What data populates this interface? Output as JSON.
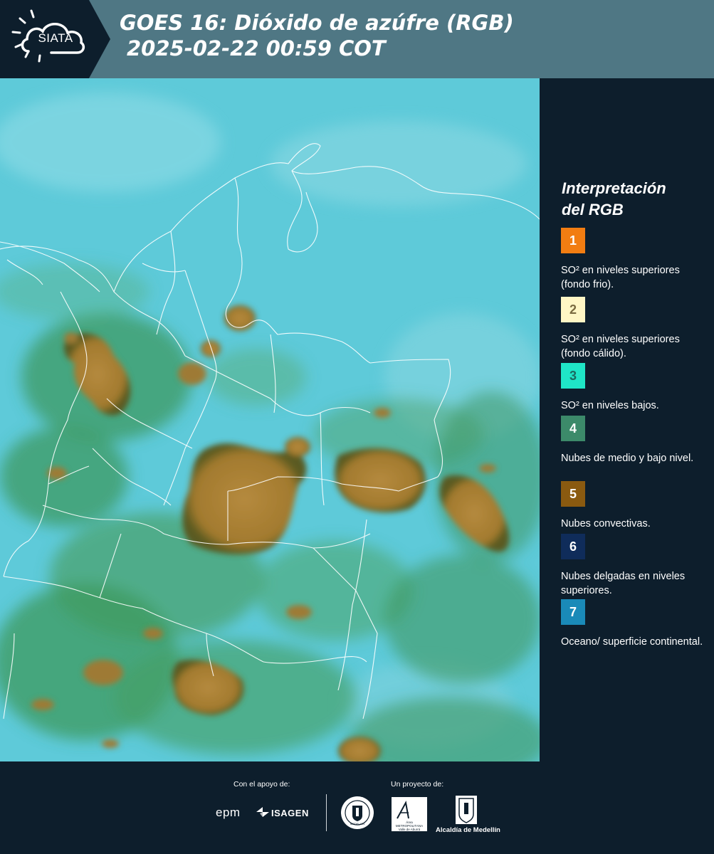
{
  "header": {
    "logo_text": "SIATA",
    "title_line1": "GOES 16: Dióxido de azúfre (RGB)",
    "title_line2": "2025-02-22 00:59 COT"
  },
  "legend": {
    "title_line1": "Interpretación",
    "title_line2": "del RGB",
    "items": [
      {
        "number": "1",
        "color": "#f27d12",
        "label": "SO² en niveles superiores (fondo frio)."
      },
      {
        "number": "2",
        "color": "#fff6c5",
        "label": "SO² en niveles superiores (fondo cálido)."
      },
      {
        "number": "3",
        "color": "#1fe6c7",
        "label": "SO² en niveles bajos."
      },
      {
        "number": "4",
        "color": "#3c8a6a",
        "label": "Nubes de medio y bajo nivel."
      },
      {
        "number": "5",
        "color": "#8a5a10",
        "label": "Nubes convectivas."
      },
      {
        "number": "6",
        "color": "#0f2c5a",
        "label": "Nubes delgadas en niveles superiores."
      },
      {
        "number": "7",
        "color": "#1a8ab8",
        "label": "Oceano/ superficie continental."
      }
    ]
  },
  "footer": {
    "support_label": "Con el apoyo de:",
    "project_label": "Un proyecto de:",
    "sponsors": [
      "epm",
      "ISAGEN"
    ],
    "partners": [
      "MEDELLÍN",
      "Área METROPOLITANA Valle de Aburrá",
      "Alcaldía de Medellín"
    ]
  }
}
